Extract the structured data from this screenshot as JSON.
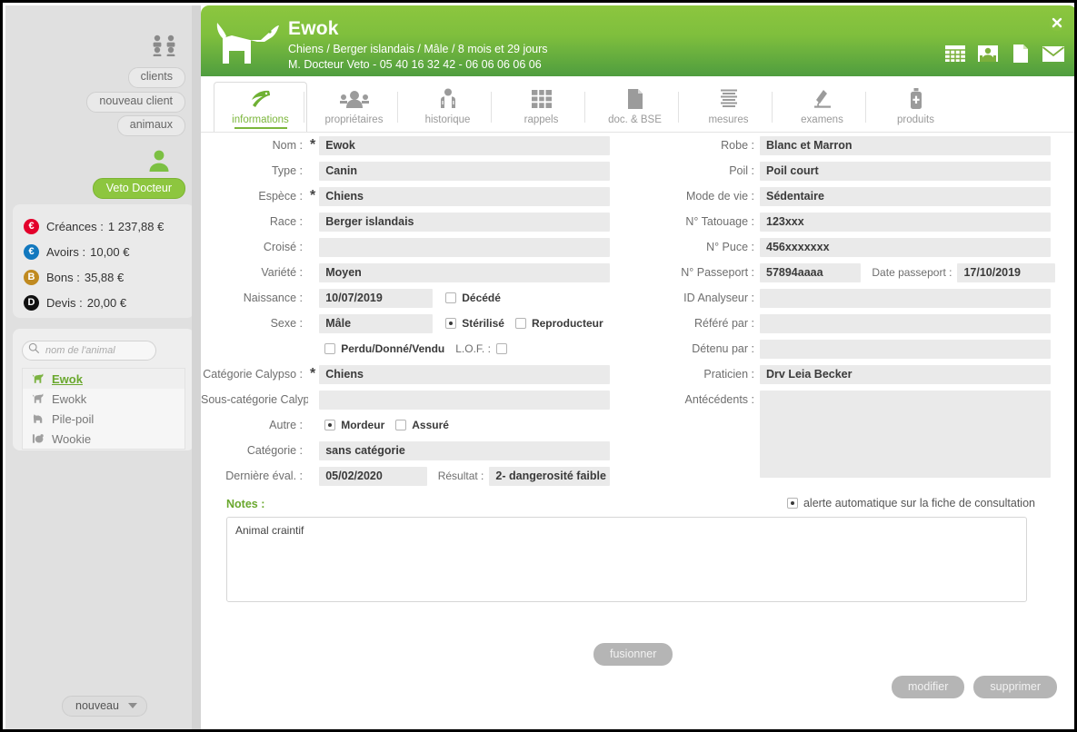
{
  "sidebar": {
    "clients_icon": "clients-group-icon",
    "buttons": [
      {
        "id": "clients",
        "label": "clients"
      },
      {
        "id": "nouveau_client",
        "label": "nouveau client"
      },
      {
        "id": "animaux",
        "label": "animaux"
      }
    ],
    "user_icon": "user-icon",
    "user_button": "Veto Docteur",
    "user_button_color": "#8dc63f",
    "balances": [
      {
        "badge": "€",
        "badge_color": "#e3002b",
        "label": "Créances :",
        "value": "1 237,88 €"
      },
      {
        "badge": "€",
        "badge_color": "#1278be",
        "label": "Avoirs :",
        "value": "10,00 €"
      },
      {
        "badge": "B",
        "badge_color": "#c08a20",
        "label": "Bons :",
        "value": "35,88 €"
      },
      {
        "badge": "D",
        "badge_color": "#111111",
        "label": "Devis :",
        "value": "20,00 €"
      }
    ],
    "search": {
      "placeholder": "nom de l'animal",
      "value": "",
      "icon": "search-icon"
    },
    "animals": [
      {
        "label": "Ewok",
        "icon": "dog-icon",
        "selected": true
      },
      {
        "label": "Ewokk",
        "icon": "dog-icon",
        "selected": false
      },
      {
        "label": "Pile-poil",
        "icon": "cat-icon",
        "selected": false
      },
      {
        "label": "Wookie",
        "icon": "rodent-icon",
        "selected": false
      }
    ],
    "new_button": "nouveau"
  },
  "header": {
    "logo_icon": "dog-logo-icon",
    "pet_name": "Ewok",
    "subtitle_1": "Chiens / Berger islandais  / Mâle / 8 mois et 29 jours",
    "subtitle_2": "M. Docteur Veto - 05 40 16 32 42 - 06 06 06 06 06",
    "gradient_top": "#8cc63f",
    "gradient_bottom": "#4f9d3f",
    "close_icon": "close-icon",
    "icons": [
      {
        "name": "calendar-icon"
      },
      {
        "name": "contact-card-icon"
      },
      {
        "name": "document-icon"
      },
      {
        "name": "mail-icon"
      }
    ]
  },
  "tabs": [
    {
      "label": "informations",
      "icon": "leaf-icon",
      "active": true
    },
    {
      "label": "propriétaires",
      "icon": "people-icon",
      "active": false
    },
    {
      "label": "historique",
      "icon": "history-icon",
      "active": false
    },
    {
      "label": "rappels",
      "icon": "grid-icon",
      "active": false
    },
    {
      "label": "doc. & BSE",
      "icon": "document-icon",
      "active": false
    },
    {
      "label": "mesures",
      "icon": "measures-icon",
      "active": false
    },
    {
      "label": "examens",
      "icon": "microscope-icon",
      "active": false
    },
    {
      "label": "produits",
      "icon": "bottle-icon",
      "active": false
    }
  ],
  "form": {
    "left": {
      "nom": {
        "label": "Nom :",
        "required": true,
        "value": "Ewok"
      },
      "type": {
        "label": "Type :",
        "required": false,
        "value": "Canin"
      },
      "espece": {
        "label": "Espèce :",
        "required": true,
        "value": "Chiens"
      },
      "race": {
        "label": "Race :",
        "required": false,
        "value": "Berger islandais"
      },
      "croise": {
        "label": "Croisé :",
        "required": false,
        "value": ""
      },
      "variete": {
        "label": "Variété :",
        "required": false,
        "value": "Moyen"
      },
      "naissance": {
        "label": "Naissance :",
        "required": false,
        "value": "10/07/2019"
      },
      "decede": {
        "label": "Décédé",
        "checked": false
      },
      "sexe": {
        "label": "Sexe :",
        "required": false,
        "value": "Mâle"
      },
      "sterilise": {
        "label": "Stérilisé",
        "checked": true
      },
      "reproducteur": {
        "label": "Reproducteur",
        "checked": false
      },
      "perdu": {
        "label": "Perdu/Donné/Vendu",
        "checked": false
      },
      "lof": {
        "label": "L.O.F. :",
        "checked": false
      },
      "cat_calypso": {
        "label": "Catégorie Calypso :",
        "required": true,
        "value": "Chiens"
      },
      "souscat": {
        "label": "Sous-catégorie Calyps",
        "required": false,
        "value": ""
      },
      "autre": {
        "label": "Autre :"
      },
      "mordeur": {
        "label": "Mordeur",
        "checked": true
      },
      "assure": {
        "label": "Assuré",
        "checked": false
      },
      "categorie": {
        "label": "Catégorie :",
        "required": false,
        "value": "sans catégorie"
      },
      "derniere_eval": {
        "label": "Dernière éval. :",
        "required": false,
        "value": "05/02/2020"
      },
      "resultat": {
        "label": "Résultat :",
        "required": false,
        "value": "2- dangerosité faible"
      }
    },
    "right": {
      "robe": {
        "label": "Robe :",
        "value": "Blanc et Marron"
      },
      "poil": {
        "label": "Poil :",
        "value": "Poil court"
      },
      "mode_vie": {
        "label": "Mode de vie :",
        "value": "Sédentaire"
      },
      "tatouage": {
        "label": "N° Tatouage :",
        "value": "123xxx"
      },
      "puce": {
        "label": "N° Puce :",
        "value": "456xxxxxxx"
      },
      "passeport": {
        "label": "N° Passeport :",
        "value": "57894aaaa"
      },
      "date_pass": {
        "label": "Date passeport :",
        "value": "17/10/2019"
      },
      "id_analyseur": {
        "label": "ID Analyseur :",
        "value": ""
      },
      "refere_par": {
        "label": "Référé par :",
        "value": ""
      },
      "detenu_par": {
        "label": "Détenu par :",
        "value": ""
      },
      "praticien": {
        "label": "Praticien :",
        "value": "Drv Leia Becker"
      },
      "antecedents": {
        "label": "Antécédents :",
        "value": ""
      }
    }
  },
  "notes": {
    "label": "Notes :",
    "label_color": "#6aa82e",
    "alert_label": "alerte automatique sur la fiche de consultation",
    "alert_checked": true,
    "value": "Animal craintif"
  },
  "actions": {
    "fusionner": "fusionner",
    "modifier": "modifier",
    "supprimer": "supprimer"
  }
}
